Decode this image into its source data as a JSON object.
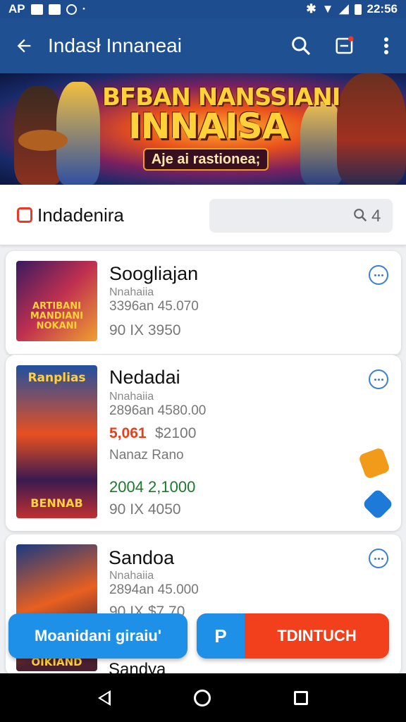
{
  "status_bar": {
    "left_text": "AP",
    "time": "22:56",
    "icons": [
      "n-badge-icon",
      "image-icon",
      "sync-icon",
      "dot-icon",
      "bluetooth-icon",
      "wifi-icon",
      "signal-icon",
      "battery-icon"
    ]
  },
  "app_bar": {
    "title": "Indasł Innaneai",
    "back_icon": "arrow-back-icon",
    "actions": [
      "search-icon",
      "notes-icon",
      "more-vert-icon"
    ]
  },
  "banner": {
    "title_line1": "BFBAN NANSSIANI",
    "title_line2": "INNAISA",
    "subtitle": "Aje ai rastionea;"
  },
  "search_row": {
    "label": "Indadenira",
    "count": "4"
  },
  "items": [
    {
      "title": "Soogliajan",
      "subtitle": "Nnahaiia",
      "meta": "3396an 45.070",
      "price": "90 IX  3950",
      "thumb_text": "ARTIBANI MANDIANI NOKANI"
    },
    {
      "title": "Nedadai",
      "subtitle": "Nnahaiia",
      "meta": "2896an 4580.00",
      "price_highlight": "5,061",
      "price": "$2100",
      "extra_label": "Nanaz Rano",
      "green_price": "2004 2,1000",
      "price_bottom": "90 IX  4050",
      "thumb_top_text": "Ranplias",
      "thumb_bottom_text": "BENNAB"
    },
    {
      "title": "Sandoa",
      "subtitle": "Nnahaiia",
      "meta": "2894an 45.000",
      "price": "90 IX  $7.70",
      "thumb_text": "OIKIAND"
    },
    {
      "title": "Sandya"
    }
  ],
  "buttons": {
    "left_label": "Moanidani giraiu'",
    "right_icon_text": "P",
    "right_label": "TDINTUCH"
  },
  "nav_bar": [
    "back-nav-icon",
    "home-nav-icon",
    "recents-nav-icon"
  ]
}
